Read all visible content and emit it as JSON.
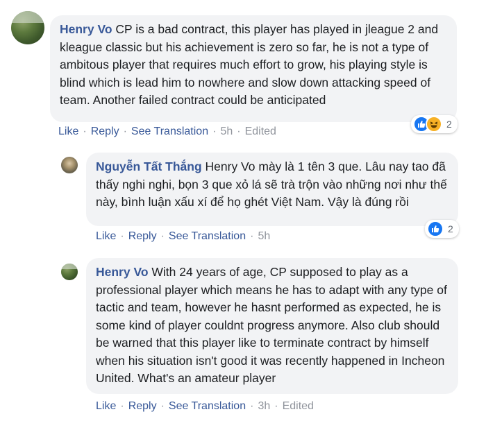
{
  "comments": [
    {
      "author": "Henry Vo",
      "text": "CP is a bad contract, this player has played in jleague 2 and kleague classic but his achievement is zero so far, he is not a type of ambitous player that requires much effort to grow, his playing style is blind which is lead him to nowhere and slow down attacking speed of team. Another failed contract could be anticipated",
      "actions": {
        "like": "Like",
        "reply": "Reply",
        "translate": "See Translation",
        "time": "5h",
        "edited": "Edited"
      },
      "reaction_count": "2",
      "reaction_icons": [
        "like-icon",
        "haha-icon"
      ]
    },
    {
      "author": "Nguyễn Tất Thắng",
      "text": "Henry Vo mày là 1 tên 3 que. Lâu nay tao đã thấy nghi nghi, bọn 3 que xỏ lá sẽ trà trộn vào những nơi như thế này, bình luận xấu xí để họ ghét Việt Nam. Vậy là đúng rồi",
      "actions": {
        "like": "Like",
        "reply": "Reply",
        "translate": "See Translation",
        "time": "5h"
      },
      "reaction_count": "2",
      "reaction_icons": [
        "like-icon"
      ]
    },
    {
      "author": "Henry Vo",
      "text": "With 24 years of age, CP supposed to play as a professional player which means he has to adapt with any type of tactic and team, however he hasnt performed as expected, he is some kind of player couldnt progress anymore. Also club should be warned that this player like to terminate contract by himself when his situation isn't good it was recently happened in Incheon United. What's an amateur player",
      "actions": {
        "like": "Like",
        "reply": "Reply",
        "translate": "See Translation",
        "time": "3h",
        "edited": "Edited"
      }
    }
  ],
  "colors": {
    "name": "#385898",
    "bubble": "#f2f3f5",
    "meta": "#90949c",
    "like": "#1877f2",
    "haha": "#f7b125"
  }
}
